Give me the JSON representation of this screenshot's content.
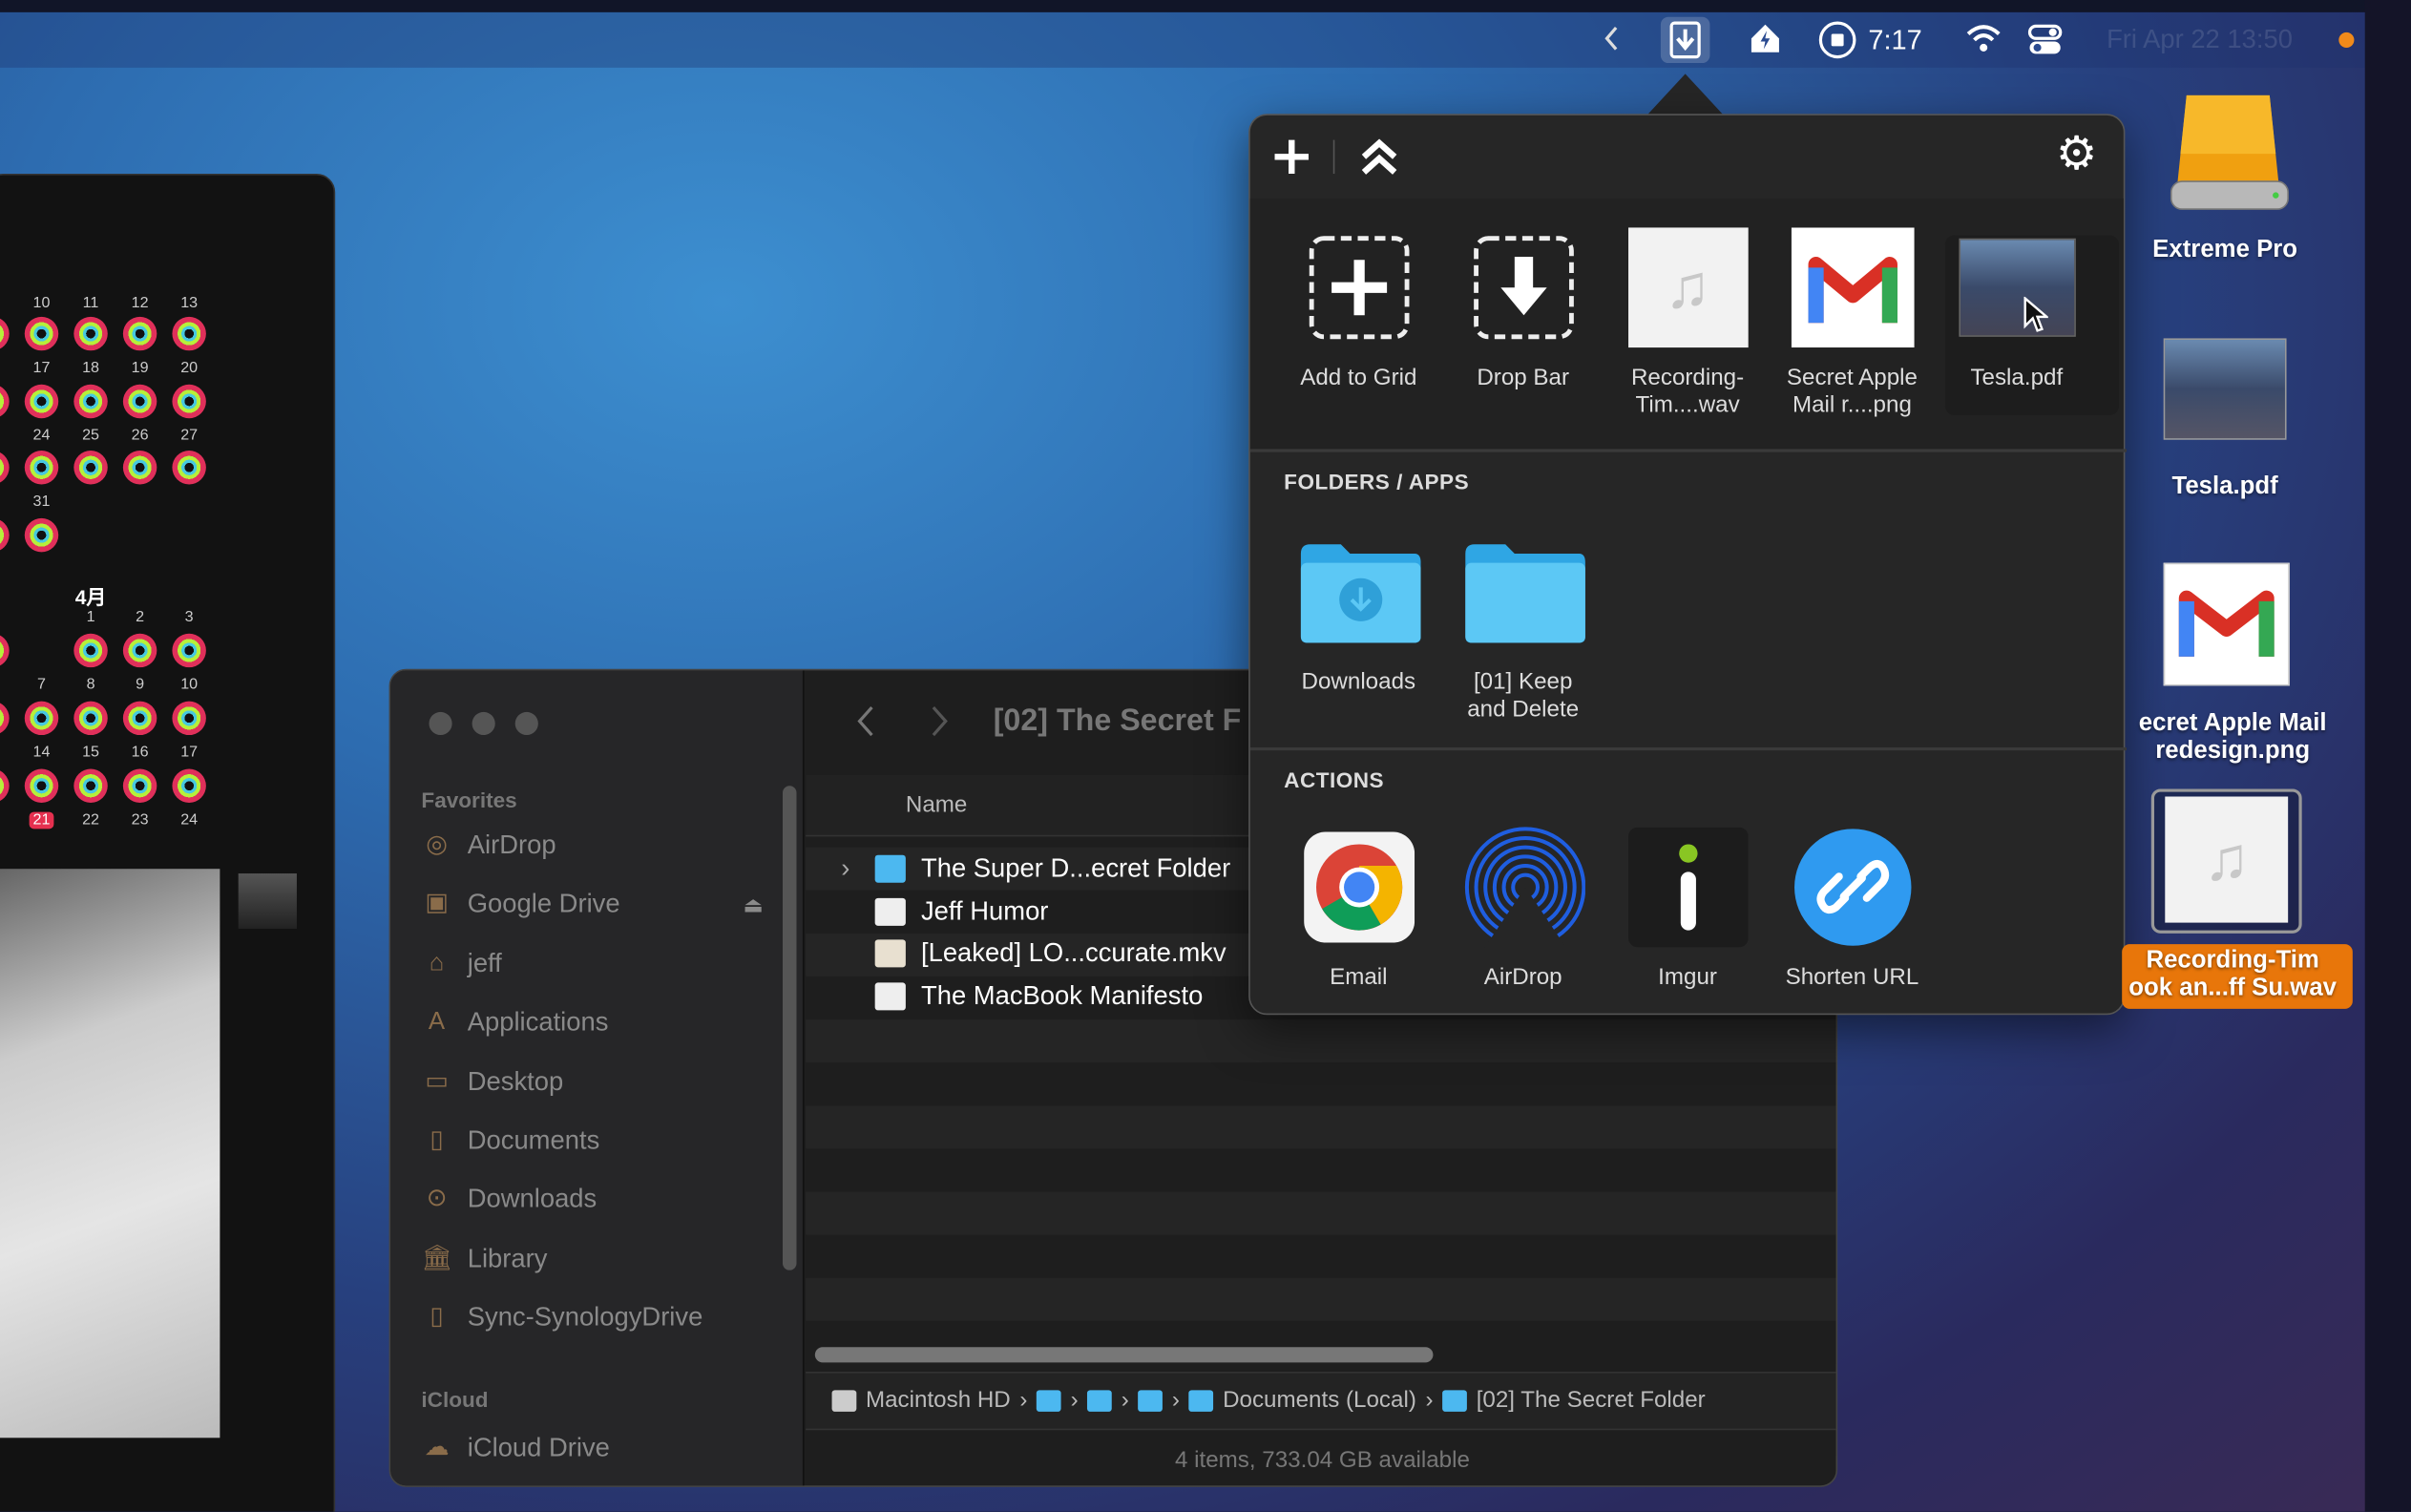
{
  "menubar": {
    "time": "7:17",
    "datetime": "Fri Apr 22  13:50",
    "icons": [
      "chevron-left-icon",
      "dropzone-icon",
      "home-bolt-icon",
      "record-icon",
      "wifi-icon",
      "control-center-icon"
    ]
  },
  "calendar": {
    "month_label": "4月",
    "rows_before": [
      [
        "10",
        "11",
        "12",
        "13"
      ],
      [
        "17",
        "18",
        "19",
        "20"
      ],
      [
        "24",
        "25",
        "26",
        "27"
      ],
      [
        "31"
      ]
    ],
    "rows_after": [
      [
        "1",
        "2",
        "3"
      ],
      [
        "7",
        "8",
        "9",
        "10"
      ],
      [
        "14",
        "15",
        "16",
        "17"
      ]
    ],
    "last_row": [
      "21",
      "22",
      "23",
      "24"
    ],
    "today": "21"
  },
  "popover": {
    "grid": [
      {
        "label1": "Add to Grid",
        "label2": "",
        "icon": "add-dashed-icon"
      },
      {
        "label1": "Drop Bar",
        "label2": "",
        "icon": "download-dashed-icon"
      },
      {
        "label1": "Recording-",
        "label2": "Tim....wav",
        "icon": "audio-file-icon"
      },
      {
        "label1": "Secret Apple",
        "label2": "Mail r....png",
        "icon": "gmail-icon"
      },
      {
        "label1": "Tesla.pdf",
        "label2": "",
        "icon": "pdf-thumbnail-icon"
      }
    ],
    "folders_title": "FOLDERS / APPS",
    "folders": [
      {
        "label1": "Downloads",
        "label2": ""
      },
      {
        "label1": "[01] Keep",
        "label2": "and Delete"
      }
    ],
    "actions_title": "ACTIONS",
    "actions": [
      {
        "label": "Email"
      },
      {
        "label": "AirDrop"
      },
      {
        "label": "Imgur"
      },
      {
        "label": "Shorten URL"
      }
    ]
  },
  "finder": {
    "title": "[02] The Secret F",
    "sidebar": {
      "favorites_header": "Favorites",
      "favorites": [
        "AirDrop",
        "Google Drive",
        "jeff",
        "Applications",
        "Desktop",
        "Documents",
        "Downloads",
        "Library",
        "Sync-SynologyDrive"
      ],
      "icloud_header": "iCloud",
      "icloud": [
        "iCloud Drive"
      ]
    },
    "column_name": "Name",
    "files": [
      "The Super D...ecret Folder",
      "Jeff Humor",
      "[Leaked] LO...ccurate.mkv",
      "The MacBook Manifesto"
    ],
    "path": [
      "Macintosh HD",
      "",
      "",
      "",
      "Documents (Local)",
      "[02] The Secret Folder"
    ],
    "status": "4 items, 733.04 GB available"
  },
  "desktop": {
    "items": [
      {
        "label1": "Extreme Pro",
        "label2": ""
      },
      {
        "label1": "Tesla.pdf",
        "label2": ""
      },
      {
        "label1": "ecret Apple Mail",
        "label2": "redesign.png"
      },
      {
        "label1": "Recording-Tim",
        "label2": "ook an...ff Su.wav"
      }
    ],
    "selection_color": "#e8760a"
  }
}
